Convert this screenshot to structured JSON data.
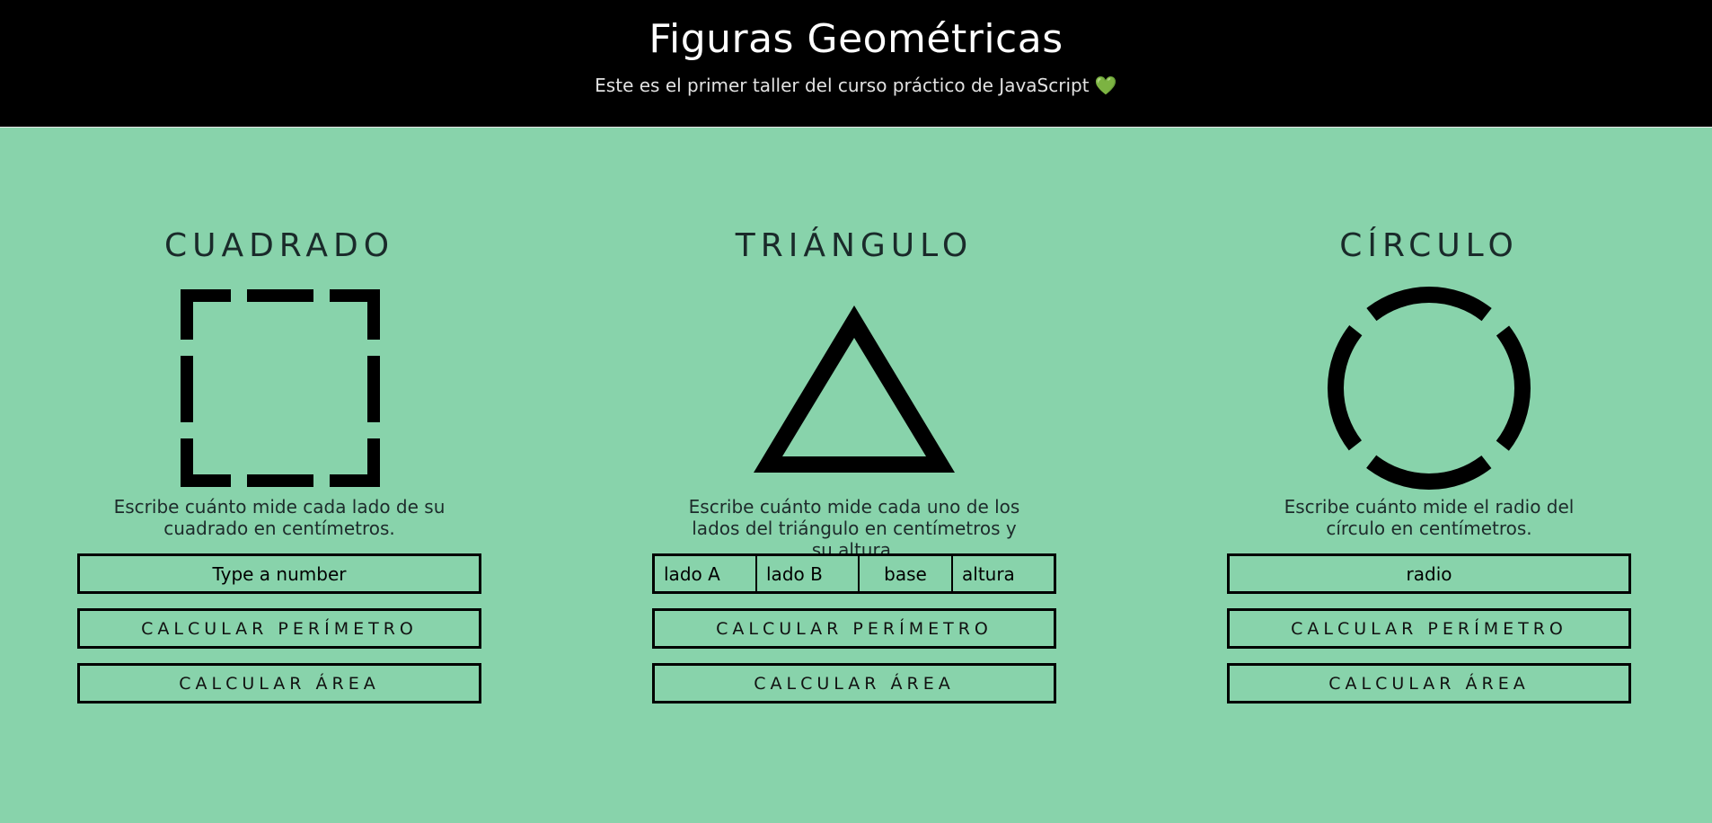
{
  "header": {
    "title": "Figuras Geométricas",
    "subtitle": "Este es el primer taller del curso práctico de JavaScript",
    "subtitle_icon": "green-heart-icon",
    "heart_glyph": "💚"
  },
  "colors": {
    "background": "#88d3ab",
    "header_bg": "#000000",
    "heart": "#2fbf3b"
  },
  "square": {
    "title": "CUADRADO",
    "icon": "dashed-square-icon",
    "description": "Escribe cuánto mide cada lado de su cuadrado en centímetros.",
    "input_placeholder": "Type a number",
    "perimeter_label": "Calcular perímetro",
    "area_label": "Calcular área"
  },
  "triangle": {
    "title": "TRIÁNGULO",
    "icon": "triangle-icon",
    "description": "Escribe cuánto mide cada uno de los lados del triángulo en centímetros y su altura.",
    "inputs": [
      "lado A",
      "lado B",
      "base",
      "altura"
    ],
    "perimeter_label": "Calcular perímetro",
    "area_label": "Calcular área"
  },
  "circle": {
    "title": "CÍRCULO",
    "icon": "dashed-circle-icon",
    "description": "Escribe cuánto mide el radio del círculo en centímetros.",
    "input_placeholder": "radio",
    "perimeter_label": "Calcular perímetro",
    "area_label": "Calcular área"
  }
}
